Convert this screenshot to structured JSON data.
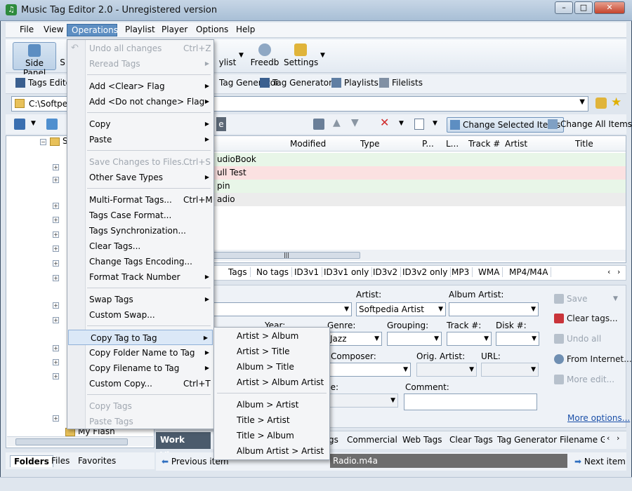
{
  "app": {
    "title": "Music Tag Editor 2.0 - Unregistered version",
    "icon": "music-tag-editor-icon"
  },
  "window_buttons": {
    "minimize": "–",
    "maximize": "□",
    "close": "✕"
  },
  "menubar": {
    "items": [
      "File",
      "View",
      "Operations",
      "Playlist",
      "Player",
      "Options",
      "Help"
    ],
    "active": "Operations"
  },
  "toolbar1": {
    "side_panel": "Side Panel",
    "side_panel_partial": "S",
    "playlist_partial": "ylist",
    "freedb": "Freedb",
    "settings": "Settings"
  },
  "toolbar2": {
    "tags_editor": "Tags Editor",
    "tag_generator_1": "Tag Generator",
    "tag_generator_2": "Tag Generator",
    "playlists": "Playlists",
    "filelists": "Filelists"
  },
  "pathbar": {
    "path": "C:\\Softped"
  },
  "toolbar3": {
    "change_selected": "Change Selected Items",
    "change_all": "Change All Items",
    "partial_e": "e"
  },
  "filelist": {
    "columns": [
      "Modified",
      "Type",
      "P...",
      "L...",
      "Track #",
      "Artist",
      "Title"
    ],
    "rows": [
      {
        "name_partial": "udioBook",
        "bg": "#e8f6e8"
      },
      {
        "name_partial": "ull Test",
        "bg": "#fbe1e1"
      },
      {
        "name_partial": "pin",
        "bg": "#e8f6e8"
      },
      {
        "name_partial": "adio",
        "bg": "#ececec"
      }
    ]
  },
  "filter_tabs": [
    "Tags",
    "No tags",
    "ID3v1",
    "ID3v1 only",
    "ID3v2",
    "ID3v2 only",
    "MP3",
    "WMA",
    "MP4/M4A"
  ],
  "editor": {
    "artist_label": "Artist:",
    "artist_value": "Softpedia Artist",
    "album_artist_label": "Album Artist:",
    "year_label": "Year:",
    "genre_label": "Genre:",
    "genre_value": "Jazz",
    "grouping_label": "Grouping:",
    "track_label": "Track #:",
    "disk_label": "Disk #:",
    "composer_label": "Composer:",
    "orig_artist_label": "Orig. Artist:",
    "url_label": "URL:",
    "age_partial": "ge:",
    "comment_label": "Comment:",
    "more_options": "More options..."
  },
  "side_actions": {
    "save": "Save",
    "clear_tags": "Clear tags...",
    "undo_all": "Undo all",
    "from_internet": "From Internet...",
    "more_edit": "More edit..."
  },
  "tree": {
    "folder_label_partial": "S",
    "last_item": "My Flash"
  },
  "left_tabs": [
    "Folders",
    "Files",
    "Favorites"
  ],
  "bottom_tabs": {
    "work_views": "Work Views",
    "items": [
      "gs",
      "Commercial",
      "Web Tags",
      "Clear Tags",
      "Tag Generator",
      "Filename G"
    ]
  },
  "nav": {
    "previous": "Previous item",
    "next": "Next item",
    "current_file": "Radio.m4a"
  },
  "operations_menu": {
    "groups": [
      [
        {
          "label": "Undo all changes",
          "shortcut": "Ctrl+Z",
          "disabled": true,
          "submenu": false
        },
        {
          "label": "Reread Tags",
          "shortcut": "",
          "disabled": true,
          "submenu": true
        }
      ],
      [
        {
          "label": "Add <Clear> Flag",
          "shortcut": "",
          "disabled": false,
          "submenu": true
        },
        {
          "label": "Add <Do not change> Flag",
          "shortcut": "",
          "disabled": false,
          "submenu": true
        }
      ],
      [
        {
          "label": "Copy",
          "shortcut": "",
          "disabled": false,
          "submenu": true
        },
        {
          "label": "Paste",
          "shortcut": "",
          "disabled": false,
          "submenu": true
        }
      ],
      [
        {
          "label": "Save Changes to Files...",
          "shortcut": "Ctrl+S",
          "disabled": true,
          "submenu": false
        },
        {
          "label": "Other Save Types",
          "shortcut": "",
          "disabled": false,
          "submenu": true
        }
      ],
      [
        {
          "label": "Multi-Format Tags...",
          "shortcut": "Ctrl+M",
          "disabled": false,
          "submenu": false
        },
        {
          "label": "Tags Case Format...",
          "shortcut": "",
          "disabled": false,
          "submenu": false
        },
        {
          "label": "Tags Synchronization...",
          "shortcut": "",
          "disabled": false,
          "submenu": false
        },
        {
          "label": "Clear Tags...",
          "shortcut": "",
          "disabled": false,
          "submenu": false
        },
        {
          "label": "Change Tags Encoding...",
          "shortcut": "",
          "disabled": false,
          "submenu": false
        },
        {
          "label": "Format Track Number",
          "shortcut": "",
          "disabled": false,
          "submenu": true
        }
      ],
      [
        {
          "label": "Swap Tags",
          "shortcut": "",
          "disabled": false,
          "submenu": true
        },
        {
          "label": "Custom Swap...",
          "shortcut": "",
          "disabled": false,
          "submenu": false
        }
      ],
      [
        {
          "label": "Copy Tag to Tag",
          "shortcut": "",
          "disabled": false,
          "submenu": true,
          "highlighted": true
        },
        {
          "label": "Copy Folder Name to Tag",
          "shortcut": "",
          "disabled": false,
          "submenu": true
        },
        {
          "label": "Copy Filename to Tag",
          "shortcut": "",
          "disabled": false,
          "submenu": true
        },
        {
          "label": "Custom Copy...",
          "shortcut": "Ctrl+T",
          "disabled": false,
          "submenu": false
        }
      ],
      [
        {
          "label": "Copy Tags",
          "shortcut": "",
          "disabled": true,
          "submenu": false
        },
        {
          "label": "Paste Tags",
          "shortcut": "",
          "disabled": true,
          "submenu": false
        }
      ]
    ]
  },
  "copy_tag_submenu": {
    "groups": [
      [
        "Artist > Album",
        "Artist > Title",
        "Album > Title",
        "Artist > Album Artist"
      ],
      [
        "Album > Artist",
        "Title > Artist",
        "Title > Album",
        "Album Artist > Artist"
      ]
    ]
  },
  "colors": {
    "menu_highlight": "#dbe8f7",
    "menubar_active": "#5d8ec2",
    "row_green": "#e8f6e8",
    "row_red": "#fbe1e1"
  }
}
